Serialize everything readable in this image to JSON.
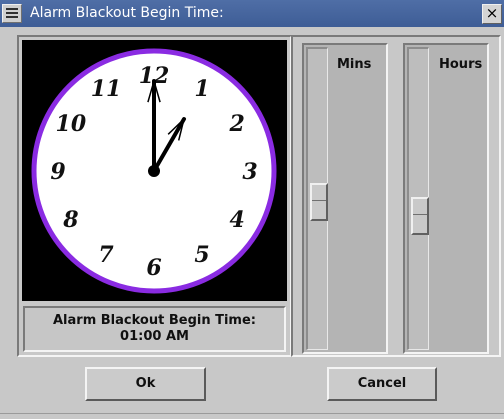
{
  "window": {
    "title": "Alarm Blackout Begin Time:",
    "close_glyph": "×",
    "menu_icon": "window-menu-icon"
  },
  "clock": {
    "numerals": [
      "12",
      "1",
      "2",
      "3",
      "4",
      "5",
      "6",
      "7",
      "8",
      "9",
      "10",
      "11"
    ],
    "time_hours": 1,
    "time_minutes": 0,
    "face_color": "#ffffff",
    "rim_color": "#8a2be2"
  },
  "status": {
    "label": "Alarm Blackout Begin Time:",
    "value": "01:00 AM"
  },
  "sliders": {
    "mins_label": "Mins",
    "hours_label": "Hours"
  },
  "buttons": {
    "ok_label": "Ok",
    "cancel_label": "Cancel"
  }
}
